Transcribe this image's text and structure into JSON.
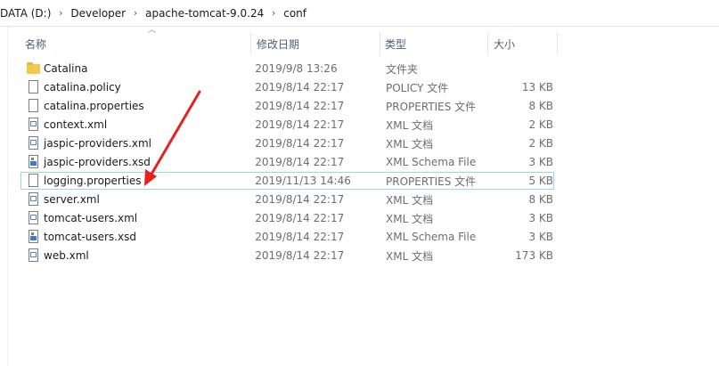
{
  "breadcrumb": [
    "DATA (D:)",
    "Developer",
    "apache-tomcat-9.0.24",
    "conf"
  ],
  "columns": {
    "name": "名称",
    "date": "修改日期",
    "type": "类型",
    "size": "大小"
  },
  "files": [
    {
      "name": "Catalina",
      "date": "2019/9/8 13:26",
      "type": "文件夹",
      "size": "",
      "icon": "folder-icon"
    },
    {
      "name": "catalina.policy",
      "date": "2019/8/14 22:17",
      "type": "POLICY 文件",
      "size": "13 KB",
      "icon": "file-icon"
    },
    {
      "name": "catalina.properties",
      "date": "2019/8/14 22:17",
      "type": "PROPERTIES 文件",
      "size": "8 KB",
      "icon": "file-icon"
    },
    {
      "name": "context.xml",
      "date": "2019/8/14 22:17",
      "type": "XML 文档",
      "size": "2 KB",
      "icon": "xml-file-icon"
    },
    {
      "name": "jaspic-providers.xml",
      "date": "2019/8/14 22:17",
      "type": "XML 文档",
      "size": "2 KB",
      "icon": "xml-file-icon"
    },
    {
      "name": "jaspic-providers.xsd",
      "date": "2019/8/14 22:17",
      "type": "XML Schema File",
      "size": "3 KB",
      "icon": "xsd-file-icon"
    },
    {
      "name": "logging.properties",
      "date": "2019/11/13 14:46",
      "type": "PROPERTIES 文件",
      "size": "5 KB",
      "icon": "file-icon"
    },
    {
      "name": "server.xml",
      "date": "2019/8/14 22:17",
      "type": "XML 文档",
      "size": "8 KB",
      "icon": "xml-file-icon"
    },
    {
      "name": "tomcat-users.xml",
      "date": "2019/8/14 22:17",
      "type": "XML 文档",
      "size": "3 KB",
      "icon": "xml-file-icon"
    },
    {
      "name": "tomcat-users.xsd",
      "date": "2019/8/14 22:17",
      "type": "XML Schema File",
      "size": "3 KB",
      "icon": "xsd-file-icon"
    },
    {
      "name": "web.xml",
      "date": "2019/8/14 22:17",
      "type": "XML 文档",
      "size": "173 KB",
      "icon": "xml-file-icon"
    }
  ],
  "highlighted_file": "logging.properties",
  "annotation_color": "#e8201f"
}
